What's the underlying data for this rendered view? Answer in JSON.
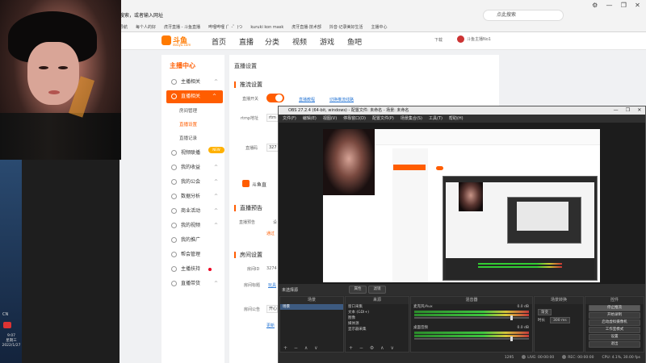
{
  "browser": {
    "address_text": "搜索，或者输入网址",
    "search_placeholder": "点此搜索",
    "window_controls": [
      "⚙",
      "—",
      "❐",
      "✕"
    ],
    "bookmarks": [
      "导航",
      "每个人的好",
      "虎牙直播 - 斗鱼直播",
      "哔哩哔哩 (゜-゜)つ",
      "kuruki kon mask",
      "虎牙直播·技术部",
      "抖音·记录美好生活",
      "主播中心"
    ]
  },
  "site": {
    "logo_text": "斗鱼",
    "logo_sub": "douyu.com",
    "nav": [
      "首页",
      "直播",
      "分类",
      "视频",
      "游戏",
      "鱼吧"
    ],
    "download_label": "下载",
    "user_label": "斗鱼主播No1"
  },
  "sidebar": {
    "title": "主播中心",
    "items": [
      {
        "label": "主播相关",
        "type": "group",
        "chevron": "^"
      },
      {
        "label": "直播相关",
        "type": "group-active",
        "chevron": "^"
      },
      {
        "label": "房间管理",
        "type": "sub"
      },
      {
        "label": "直播设置",
        "type": "sub-active"
      },
      {
        "label": "直播记录",
        "type": "sub"
      },
      {
        "label": "视频联播",
        "type": "group",
        "chevron": "^"
      },
      {
        "label": "我的收益",
        "type": "group",
        "chevron": "^"
      },
      {
        "label": "我的公会",
        "type": "group",
        "chevron": "^"
      },
      {
        "label": "数据分析",
        "type": "group",
        "chevron": "^"
      },
      {
        "label": "商业活动",
        "type": "group",
        "chevron": "^"
      },
      {
        "label": "我的视频",
        "type": "group",
        "chevron": "^"
      },
      {
        "label": "我的推广",
        "type": "group"
      },
      {
        "label": "帮会管理",
        "type": "group"
      },
      {
        "label": "主播扶持",
        "type": "group-dot"
      },
      {
        "label": "直播带货",
        "type": "group",
        "chevron": "^"
      }
    ],
    "new_badge": "NEW"
  },
  "content": {
    "page_title": "直播设置",
    "stream_section": "推流设置",
    "stream_switch_label": "直播开关",
    "tutorial_link": "直播教程",
    "switch_mode_link": "切换推流线路",
    "rtmp_label": "rtmp地址",
    "rtmp_value": "rtm",
    "key_label": "直播码",
    "key_value": "327",
    "ad_text": "斗鱼直",
    "preview_section": "直播预告",
    "preview_label": "直播预告",
    "preview_value": "设",
    "preview_link": "通过",
    "room_section": "房间设置",
    "room_id_label": "房间ID",
    "room_id_value": "3274",
    "room_title_label": "房间标题",
    "room_title_value": "玩具",
    "room_notice_label": "房间公告",
    "room_notice_value": "开心",
    "room_notice_link": "更新"
  },
  "taskbar": {
    "tag": "CN",
    "time": "9:07",
    "weekday": "星期三",
    "date": "2022/1/27"
  },
  "obs": {
    "title": "OBS 27.2.4 (64-bit, windows) - 配置文件: 未命名 - 场景: 未命名",
    "window_controls": [
      "—",
      "❐",
      "✕"
    ],
    "menu": [
      "文件(F)",
      "编辑(E)",
      "视图(V)",
      "停靠窗口(D)",
      "配置文件(P)",
      "场景集合(S)",
      "工具(T)",
      "帮助(H)"
    ],
    "scene_bar_label": "未选择源",
    "properties_button": "属性",
    "filters_button": "滤镜",
    "scenes": {
      "title": "场景",
      "items": [
        "场景"
      ]
    },
    "sources": {
      "title": "来源",
      "items": [
        "窗口采集",
        "文本 (GDI+)",
        "图像",
        "媒体源",
        "显示器采集"
      ]
    },
    "mixer": {
      "title": "混音器",
      "channels": [
        {
          "name": "麦克风/Aux",
          "db": "0.0 dB"
        },
        {
          "name": "桌面音频",
          "db": "0.0 dB"
        }
      ]
    },
    "transitions": {
      "title": "场景转换",
      "type": "渐变",
      "duration_label": "时长",
      "duration": "300 ms"
    },
    "controls": {
      "title": "控件",
      "buttons": [
        "停止推流",
        "开始录制",
        "启动虚拟摄像机",
        "工作室模式",
        "设置",
        "退出"
      ]
    },
    "status": {
      "live": "LIVE: 00:00:00",
      "rec": "REC: 00:00:00",
      "cpu": "CPU: 4.1%, 30.00 fps",
      "dropped": "1295"
    }
  }
}
